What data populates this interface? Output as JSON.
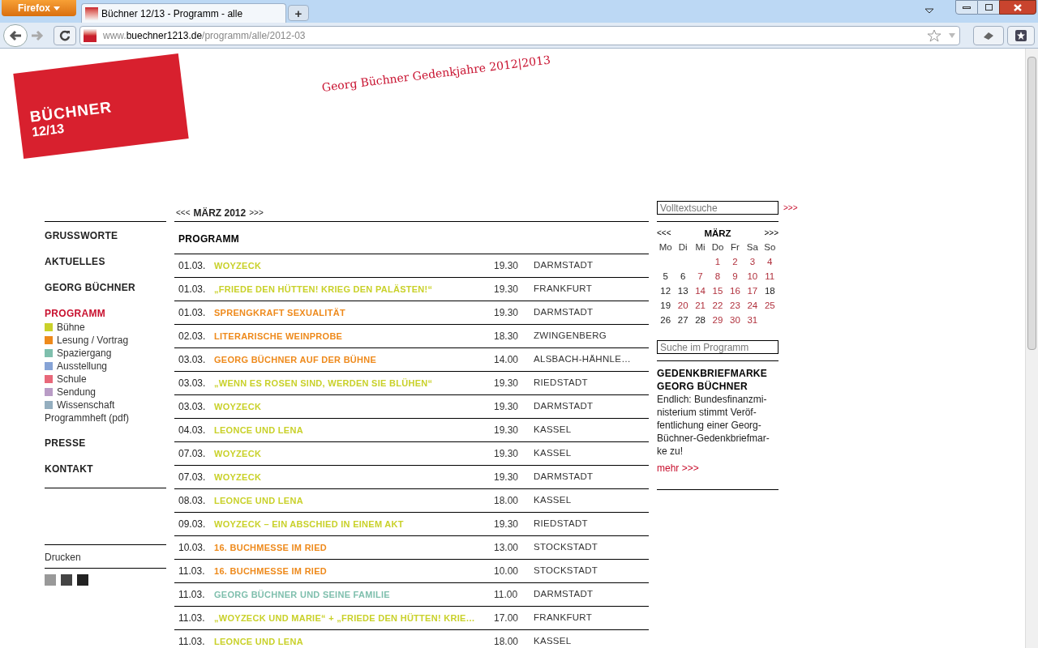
{
  "browser": {
    "menu_button": "Firefox",
    "tab_title": "Büchner 12/13 - Programm - alle",
    "new_tab": "+",
    "url_prefix": "www.",
    "url_host": "buechner1213.de",
    "url_path": "/programm/alle/2012-03"
  },
  "logo": {
    "line1": "BÜCHNER",
    "line2": "12/13"
  },
  "tagline": "Georg Büchner Gedenkjahre 2012|2013",
  "nav": [
    {
      "label": "GRUSSWORTE",
      "selected": false
    },
    {
      "label": "AKTUELLES",
      "selected": false
    },
    {
      "label": "GEORG BÜCHNER",
      "selected": false
    },
    {
      "label": "PROGRAMM",
      "selected": true,
      "categories": [
        {
          "label": "Bühne",
          "color": "#c9d12a"
        },
        {
          "label": "Lesung / Vortrag",
          "color": "#ee8a1c"
        },
        {
          "label": "Spaziergang",
          "color": "#7fbfad"
        },
        {
          "label": "Ausstellung",
          "color": "#86a3d6"
        },
        {
          "label": "Schule",
          "color": "#e8687a"
        },
        {
          "label": "Sendung",
          "color": "#b99cc6"
        },
        {
          "label": "Wissenschaft",
          "color": "#94aebf"
        }
      ],
      "extra_link": "Programmheft (pdf)"
    },
    {
      "label": "PRESSE",
      "selected": false
    },
    {
      "label": "KONTAKT",
      "selected": false
    }
  ],
  "print_link": "Drucken",
  "month_nav": {
    "prev": "<<<",
    "label": "MÄRZ 2012",
    "next": ">>>"
  },
  "program": {
    "heading": "PROGRAMM",
    "rows": [
      {
        "date": "01.03.",
        "title": "WOYZECK",
        "time": "19.30",
        "city": "DARMSTADT",
        "color": "#c9d12a"
      },
      {
        "date": "01.03.",
        "title": "„FRIEDE DEN HÜTTEN! KRIEG DEN PALÄSTEN!“",
        "time": "19.30",
        "city": "FRANKFURT",
        "color": "#c9d12a"
      },
      {
        "date": "01.03.",
        "title": "SPRENGKRAFT SEXUALITÄT",
        "time": "19.30",
        "city": "DARMSTADT",
        "color": "#ee8a1c"
      },
      {
        "date": "02.03.",
        "title": "LITERARISCHE WEINPROBE",
        "time": "18.30",
        "city": "ZWINGENBERG",
        "color": "#ee8a1c"
      },
      {
        "date": "03.03.",
        "title": "GEORG BÜCHNER AUF DER BÜHNE",
        "time": "14.00",
        "city": "ALSBACH-HÄHNLE…",
        "color": "#ee8a1c"
      },
      {
        "date": "03.03.",
        "title": "„WENN ES ROSEN SIND, WERDEN SIE BLÜHEN“",
        "time": "19.30",
        "city": "RIEDSTADT",
        "color": "#c9d12a"
      },
      {
        "date": "03.03.",
        "title": "WOYZECK",
        "time": "19.30",
        "city": "DARMSTADT",
        "color": "#c9d12a"
      },
      {
        "date": "04.03.",
        "title": "LEONCE UND LENA",
        "time": "19.30",
        "city": "KASSEL",
        "color": "#c9d12a"
      },
      {
        "date": "07.03.",
        "title": "WOYZECK",
        "time": "19.30",
        "city": "KASSEL",
        "color": "#c9d12a"
      },
      {
        "date": "07.03.",
        "title": "WOYZECK",
        "time": "19.30",
        "city": "DARMSTADT",
        "color": "#c9d12a"
      },
      {
        "date": "08.03.",
        "title": "LEONCE UND LENA",
        "time": "18.00",
        "city": "KASSEL",
        "color": "#c9d12a"
      },
      {
        "date": "09.03.",
        "title": "WOYZECK – EIN ABSCHIED IN EINEM AKT",
        "time": "19.30",
        "city": "RIEDSTADT",
        "color": "#c9d12a"
      },
      {
        "date": "10.03.",
        "title": "16. BUCHMESSE IM RIED",
        "time": "13.00",
        "city": "STOCKSTADT",
        "color": "#ee8a1c"
      },
      {
        "date": "11.03.",
        "title": "16. BUCHMESSE IM RIED",
        "time": "10.00",
        "city": "STOCKSTADT",
        "color": "#ee8a1c"
      },
      {
        "date": "11.03.",
        "title": "GEORG BÜCHNER UND SEINE FAMILIE",
        "time": "11.00",
        "city": "DARMSTADT",
        "color": "#7fbfad"
      },
      {
        "date": "11.03.",
        "title": "„WOYZECK UND MARIE“ + „FRIEDE DEN HÜTTEN! KRIE…",
        "time": "17.00",
        "city": "FRANKFURT",
        "color": "#c9d12a"
      },
      {
        "date": "11.03.",
        "title": "LEONCE UND LENA",
        "time": "18.00",
        "city": "KASSEL",
        "color": "#c9d12a"
      }
    ]
  },
  "search": {
    "placeholder": "Volltextsuche",
    "go": ">>>"
  },
  "calendar": {
    "prev": "<<<",
    "month": "MÄRZ",
    "next": ">>>",
    "weekdays": [
      "Mo",
      "Di",
      "Mi",
      "Do",
      "Fr",
      "Sa",
      "So"
    ],
    "weeks": [
      [
        {
          "day": "1",
          "linked": true
        },
        {
          "day": "2",
          "linked": true
        },
        {
          "day": "3",
          "linked": true
        },
        {
          "day": "4",
          "linked": true
        }
      ],
      [
        {
          "day": "5",
          "linked": false
        },
        {
          "day": "6",
          "linked": false
        },
        {
          "day": "7",
          "linked": true
        },
        {
          "day": "8",
          "linked": true
        },
        {
          "day": "9",
          "linked": true
        },
        {
          "day": "10",
          "linked": true
        },
        {
          "day": "11",
          "linked": true
        }
      ],
      [
        {
          "day": "12",
          "linked": false
        },
        {
          "day": "13",
          "linked": false
        },
        {
          "day": "14",
          "linked": true
        },
        {
          "day": "15",
          "linked": true
        },
        {
          "day": "16",
          "linked": true
        },
        {
          "day": "17",
          "linked": true
        },
        {
          "day": "18",
          "linked": false
        }
      ],
      [
        {
          "day": "19",
          "linked": false
        },
        {
          "day": "20",
          "linked": true
        },
        {
          "day": "21",
          "linked": true
        },
        {
          "day": "22",
          "linked": true
        },
        {
          "day": "23",
          "linked": true
        },
        {
          "day": "24",
          "linked": true
        },
        {
          "day": "25",
          "linked": true
        }
      ],
      [
        {
          "day": "26",
          "linked": false
        },
        {
          "day": "27",
          "linked": false
        },
        {
          "day": "28",
          "linked": false
        },
        {
          "day": "29",
          "linked": true
        },
        {
          "day": "30",
          "linked": true
        },
        {
          "day": "31",
          "linked": true
        }
      ]
    ]
  },
  "program_search": {
    "placeholder": "Suche im Programm"
  },
  "news": {
    "title_lines": [
      "GEDENKBRIEFMARKE",
      "GEORG BÜCHNER"
    ],
    "lines": [
      "Endlich: Bundesfinanzmi-",
      "nisterium stimmt Veröf-",
      "fentlichung einer Georg-",
      "Büchner-Gedenkbriefmar-",
      "ke zu!"
    ],
    "more": "mehr >>>"
  }
}
